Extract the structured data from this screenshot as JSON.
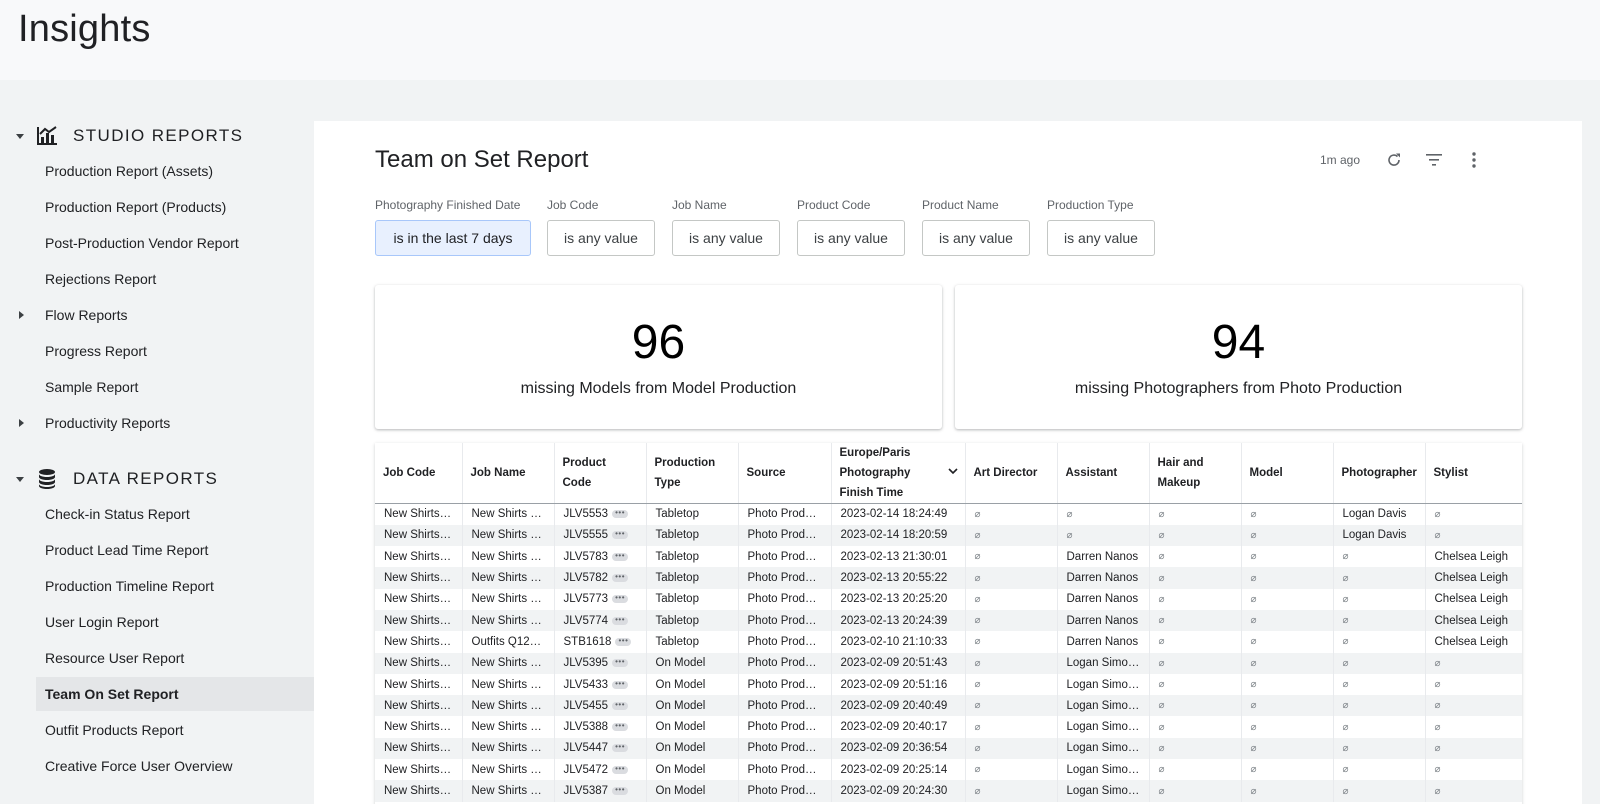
{
  "header": {
    "title": "Insights"
  },
  "sidebar": {
    "studio_label": "STUDIO REPORTS",
    "studio_items": [
      "Production Report (Assets)",
      "Production Report (Products)",
      "Post-Production Vendor Report",
      "Rejections Report",
      "Flow Reports",
      "Progress Report",
      "Sample Report",
      "Productivity Reports"
    ],
    "data_label": "DATA REPORTS",
    "data_items": [
      "Check-in Status Report",
      "Product Lead Time Report",
      "Production Timeline Report",
      "User Login Report",
      "Resource User Report",
      "Team On Set Report",
      "Outfit Products Report",
      "Creative Force User Overview"
    ],
    "active_item": "Team On Set Report"
  },
  "report": {
    "title": "Team on Set Report",
    "updated": "1m ago"
  },
  "filters": [
    {
      "label": "Photography Finished Date",
      "value": "is in the last 7 days"
    },
    {
      "label": "Job Code",
      "value": "is any value"
    },
    {
      "label": "Job Name",
      "value": "is any value"
    },
    {
      "label": "Product Code",
      "value": "is any value"
    },
    {
      "label": "Product Name",
      "value": "is any value"
    },
    {
      "label": "Production Type",
      "value": "is any value"
    }
  ],
  "kpis": [
    {
      "value": "96",
      "label": "missing Models from Model Production"
    },
    {
      "value": "94",
      "label": "missing Photographers from Photo Production"
    }
  ],
  "table": {
    "columns": [
      "Job Code",
      "Job Name",
      "Product Code",
      "Production Type",
      "Source",
      "Europe/Paris Photography Finish Time",
      "Art Director",
      "Assistant",
      "Hair and Makeup",
      "Model",
      "Photographer",
      "Stylist"
    ],
    "null_symbol": "⌀",
    "rows": [
      [
        "New Shirts…",
        "New Shirts …",
        "JLV5553",
        "Tabletop",
        "Photo Prod…",
        "2023-02-14 18:24:49",
        null,
        null,
        null,
        null,
        "Logan Davis",
        null
      ],
      [
        "New Shirts…",
        "New Shirts …",
        "JLV5555",
        "Tabletop",
        "Photo Prod…",
        "2023-02-14 18:20:59",
        null,
        null,
        null,
        null,
        "Logan Davis",
        null
      ],
      [
        "New Shirts…",
        "New Shirts …",
        "JLV5783",
        "Tabletop",
        "Photo Prod…",
        "2023-02-13 21:30:01",
        null,
        "Darren Nanos",
        null,
        null,
        null,
        "Chelsea Leigh"
      ],
      [
        "New Shirts…",
        "New Shirts …",
        "JLV5782",
        "Tabletop",
        "Photo Prod…",
        "2023-02-13 20:55:22",
        null,
        "Darren Nanos",
        null,
        null,
        null,
        "Chelsea Leigh"
      ],
      [
        "New Shirts…",
        "New Shirts …",
        "JLV5773",
        "Tabletop",
        "Photo Prod…",
        "2023-02-13 20:25:20",
        null,
        "Darren Nanos",
        null,
        null,
        null,
        "Chelsea Leigh"
      ],
      [
        "New Shirts…",
        "New Shirts …",
        "JLV5774",
        "Tabletop",
        "Photo Prod…",
        "2023-02-13 20:24:39",
        null,
        "Darren Nanos",
        null,
        null,
        null,
        "Chelsea Leigh"
      ],
      [
        "New Shirts…",
        "Outfits Q12…",
        "STB1618",
        "Tabletop",
        "Photo Prod…",
        "2023-02-10 21:10:33",
        null,
        "Darren Nanos",
        null,
        null,
        null,
        "Chelsea Leigh"
      ],
      [
        "New Shirts…",
        "New Shirts …",
        "JLV5395",
        "On Model",
        "Photo Prod…",
        "2023-02-09 20:51:43",
        null,
        "Logan Simo…",
        null,
        null,
        null,
        null
      ],
      [
        "New Shirts…",
        "New Shirts …",
        "JLV5433",
        "On Model",
        "Photo Prod…",
        "2023-02-09 20:51:16",
        null,
        "Logan Simo…",
        null,
        null,
        null,
        null
      ],
      [
        "New Shirts…",
        "New Shirts …",
        "JLV5455",
        "On Model",
        "Photo Prod…",
        "2023-02-09 20:40:49",
        null,
        "Logan Simo…",
        null,
        null,
        null,
        null
      ],
      [
        "New Shirts…",
        "New Shirts …",
        "JLV5388",
        "On Model",
        "Photo Prod…",
        "2023-02-09 20:40:17",
        null,
        "Logan Simo…",
        null,
        null,
        null,
        null
      ],
      [
        "New Shirts…",
        "New Shirts …",
        "JLV5447",
        "On Model",
        "Photo Prod…",
        "2023-02-09 20:36:54",
        null,
        "Logan Simo…",
        null,
        null,
        null,
        null
      ],
      [
        "New Shirts…",
        "New Shirts …",
        "JLV5472",
        "On Model",
        "Photo Prod…",
        "2023-02-09 20:25:14",
        null,
        "Logan Simo…",
        null,
        null,
        null,
        null
      ],
      [
        "New Shirts…",
        "New Shirts …",
        "JLV5387",
        "On Model",
        "Photo Prod…",
        "2023-02-09 20:24:30",
        null,
        "Logan Simo…",
        null,
        null,
        null,
        null
      ]
    ]
  }
}
